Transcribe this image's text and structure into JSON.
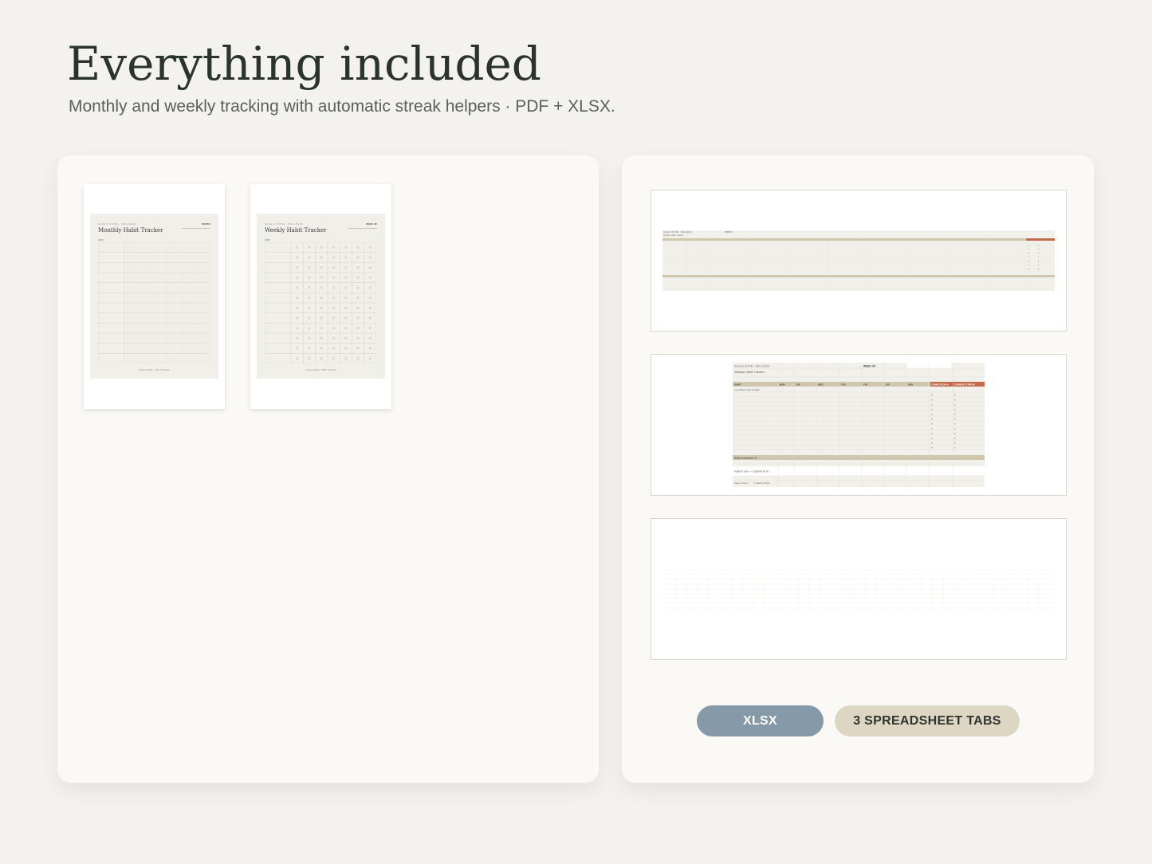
{
  "header": {
    "title": "Everything included",
    "subtitle": "Monthly and weekly tracking with automatic streak helpers · PDF + XLSX."
  },
  "pdf_pages": [
    {
      "brand": "SAGE & STONE · WELLNESS",
      "tag": "MONTH",
      "title": "Monthly Habit Tracker",
      "header_label": "HABIT",
      "footer": "SAGE & STONE · HABIT TRACKER"
    },
    {
      "brand": "SAGE & STONE · WELLNESS",
      "tag": "WEEK OF",
      "title": "Weekly Habit Tracker",
      "header_label": "HABIT",
      "day_labels": [
        "MON",
        "TUE",
        "WED",
        "THU",
        "FRI",
        "SAT",
        "SUN"
      ],
      "footer": "SAGE & STONE · HABIT TRACKER"
    }
  ],
  "spreadsheets": {
    "monthly": {
      "brand": "SAGE & STONE · WELLNESS",
      "title": "Monthly Habit Tracker",
      "month_label": "MONTH"
    },
    "weekly": {
      "brand": "SAGE & STONE · WELLNESS",
      "title": "Weekly Habit Tracker",
      "week_label": "WEEK OF:",
      "columns": [
        "HABIT",
        "MON",
        "TUE",
        "WED",
        "THU",
        "FRI",
        "SAT",
        "SUN",
        "COMPLETION %",
        "CURRENT STREAK"
      ],
      "first_habit": "e.g. Drink 8 cups of water",
      "completion_row": "Daily Completion %",
      "how_to": "How to use — column A: w",
      "footer_left": "Sage & Stone",
      "footer_right": "© Delaney Wigh..."
    }
  },
  "badges": {
    "format": "XLSX",
    "tabs": "3 SPREADSHEET TABS"
  },
  "colors": {
    "background": "#f3f2ee",
    "panel": "#faf9f6",
    "title": "#2a332c",
    "accent_blue": "#8599a9",
    "accent_sand": "#ddd6c3",
    "accent_terracotta": "#c46a4c"
  }
}
